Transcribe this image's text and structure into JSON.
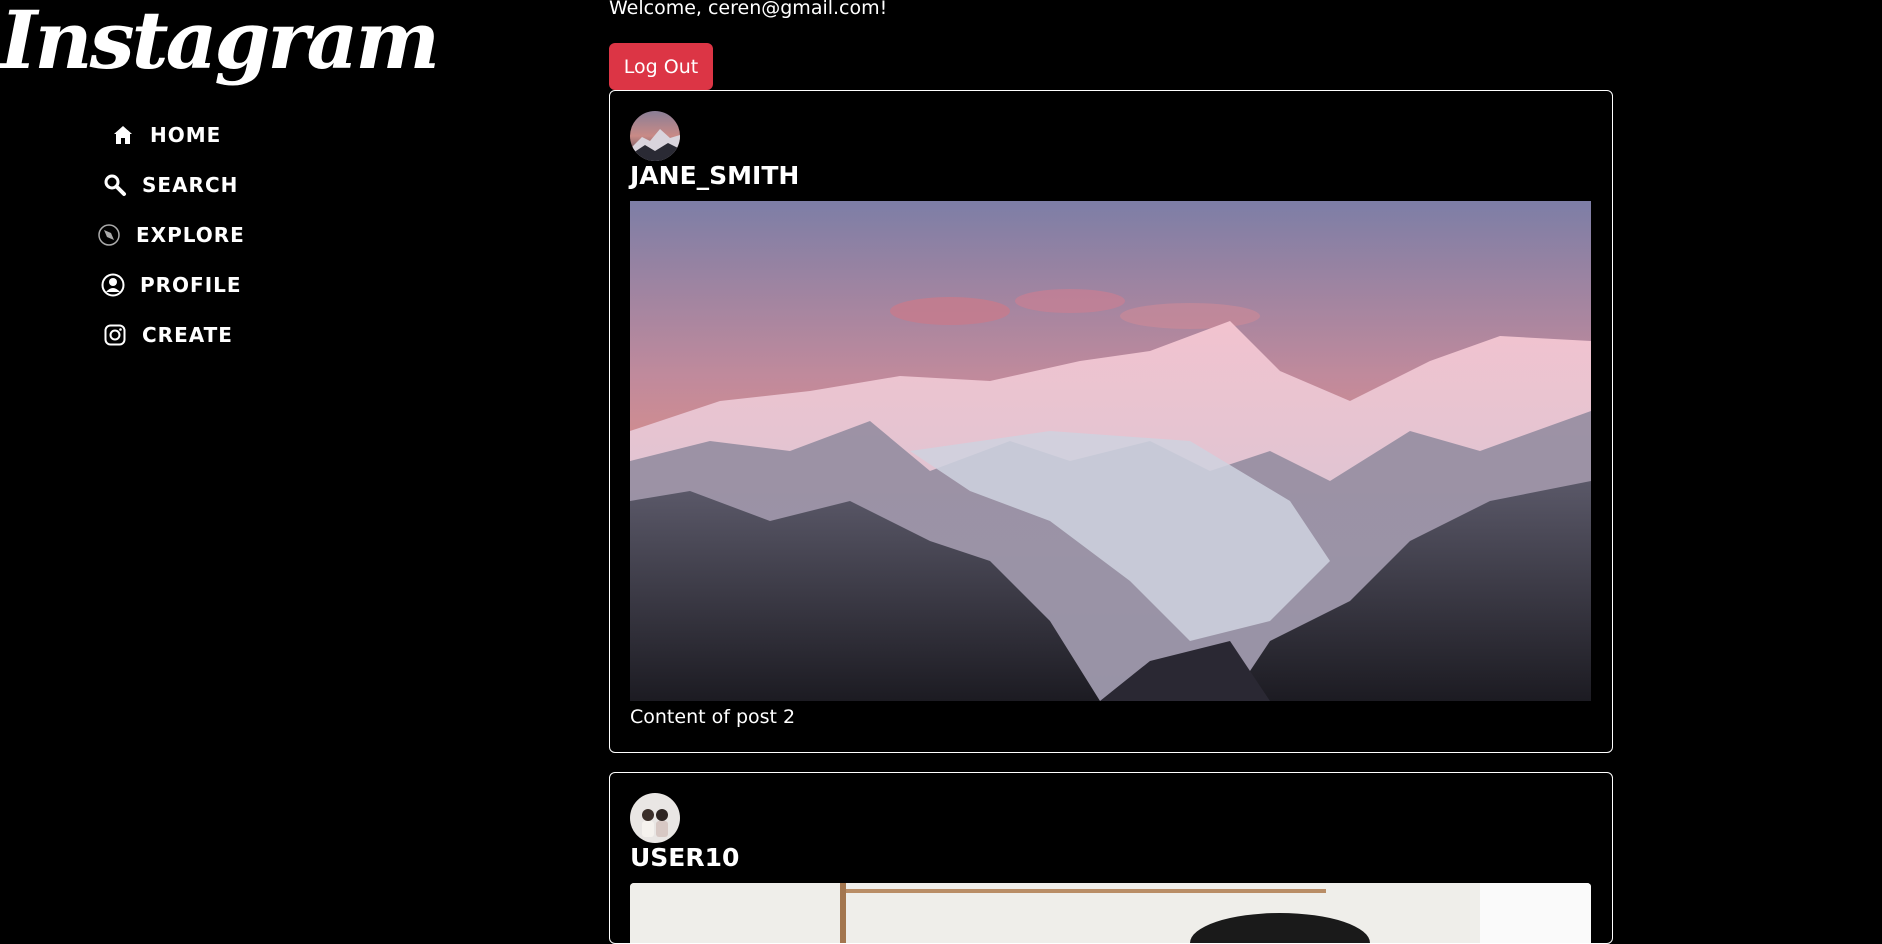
{
  "brand": {
    "logo_text": "Instagram"
  },
  "nav": {
    "items": [
      {
        "label": "HOME",
        "icon": "home-icon"
      },
      {
        "label": "SEARCH",
        "icon": "search-icon"
      },
      {
        "label": "EXPLORE",
        "icon": "compass-icon"
      },
      {
        "label": "PROFILE",
        "icon": "profile-icon"
      },
      {
        "label": "CREATE",
        "icon": "instagram-camera-icon"
      }
    ]
  },
  "header": {
    "welcome_text": "Welcome, ceren@gmail.com!",
    "logout_label": "Log Out",
    "logout_color": "#dc3545"
  },
  "posts": [
    {
      "username": "JANE_SMITH",
      "caption": "Content of post 2"
    },
    {
      "username": "USER10"
    }
  ]
}
